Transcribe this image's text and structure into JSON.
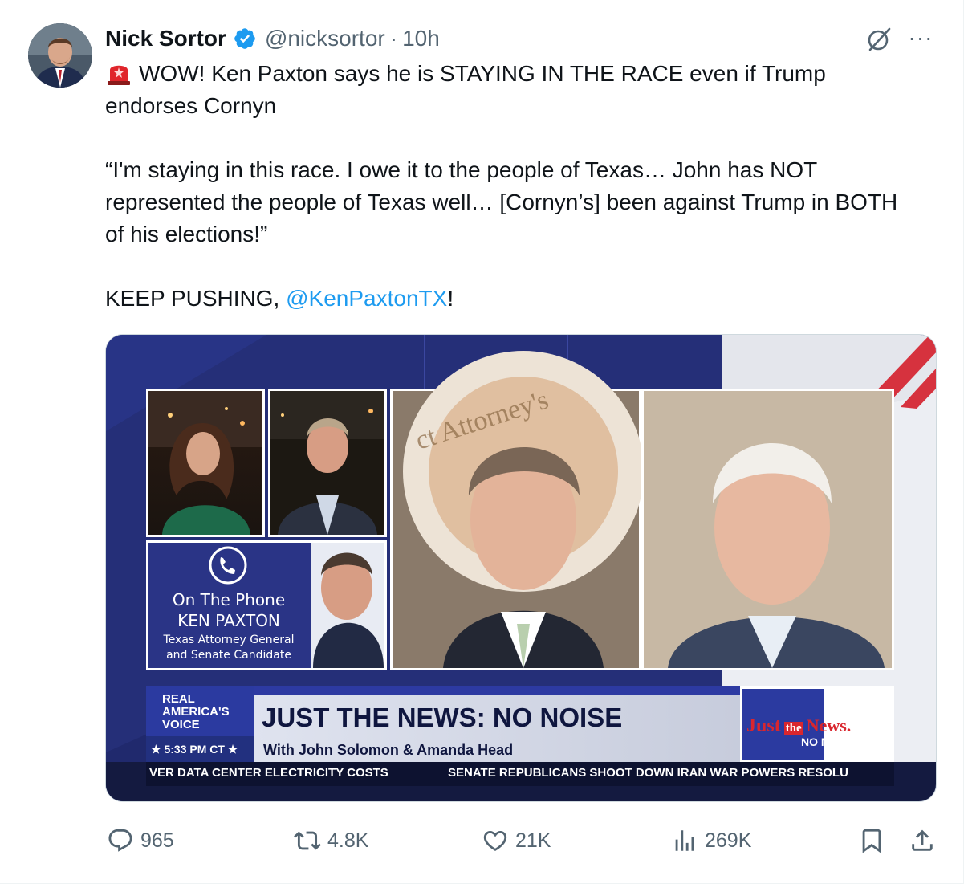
{
  "tweet": {
    "author_name": "Nick Sortor",
    "handle": "@nicksortor",
    "separator": "·",
    "time": "10h",
    "more_label": "···",
    "text": {
      "line1_prefix": "WOW! Ken Paxton says he is STAYING IN THE RACE even if Trump endorses Cornyn",
      "quote": "“I'm staying in this race. I owe it to the people of Texas… John has NOT represented the people of Texas well… [Cornyn’s] been against Trump in BOTH of his elections!”",
      "closing_prefix": "KEEP PUSHING, ",
      "mention": "@KenPaxtonTX",
      "closing_suffix": "!"
    }
  },
  "media": {
    "phone_label": "On The Phone",
    "guest_name": "KEN PAXTON",
    "guest_title1": "Texas Attorney General",
    "guest_title2": "and Senate Candidate",
    "network_line1": "REAL",
    "network_line2": "AMERICA'S",
    "network_line3": "VOICE",
    "clock": "5:33 PM CT",
    "show_title": "JUST THE NEWS: NO NOISE",
    "show_hosts": "With John Solomon & Amanda Head",
    "logo_just": "Just",
    "logo_the": "the",
    "logo_news": "News.",
    "logo_nonoise": "NO NOISE",
    "ticker_left": "VER DATA CENTER ELECTRICITY COSTS",
    "ticker_right": "SENATE REPUBLICANS SHOOT DOWN IRAN WAR POWERS RESOLU",
    "seal_text": "ct Attorney's"
  },
  "actions": {
    "replies": "965",
    "reposts": "4.8K",
    "likes": "21K",
    "views": "269K"
  },
  "colors": {
    "link": "#1d9bf0",
    "muted": "#536471",
    "verified": "#1d9bf0",
    "broadcast_blue": "#232d74",
    "ticker_bg": "#0d1230"
  }
}
